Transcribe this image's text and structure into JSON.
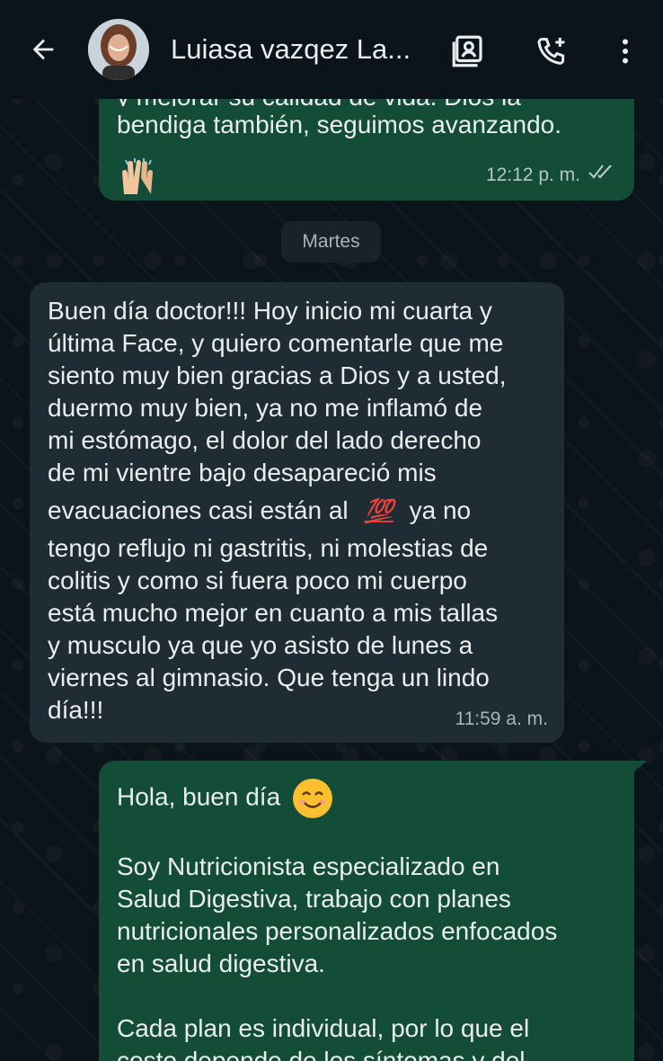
{
  "header": {
    "contact_name": "Luiasa vazqez La...",
    "back_icon": "arrow-left-icon",
    "contact_card_icon": "contact-card-icon",
    "add_call_icon": "phone-plus-icon",
    "menu_icon": "more-vertical-icon"
  },
  "messages": [
    {
      "direction": "out",
      "text": "bendiga también, seguimos avanzando.",
      "top_partial": "y mejorar su calidad de vida. Dios la",
      "emoji": "raised-hands-emoji",
      "time": "12:12 p. m.",
      "status": "read"
    },
    {
      "direction": "in",
      "text_lines": [
        "Buen día doctor!!! Hoy inicio mi cuarta y",
        "última Face, y quiero comentarle que me",
        "siento muy bien gracias a Dios y a usted,",
        "duermo muy bien, ya no me inflamó de",
        "mi estómago, el dolor del lado derecho",
        "de mi vientre bajo desapareció mis",
        "evacuaciones casi están al",
        "ya no",
        "tengo reflujo ni gastritis, ni molestias de",
        "colitis y como si fuera poco mi cuerpo",
        "está mucho mejor en cuanto a mis tallas",
        "y musculo ya que yo asisto de lunes a",
        "viernes al gimnasio. Que tenga un lindo",
        "día!!!"
      ],
      "emoji_100": "💯",
      "time": "11:59 a. m."
    },
    {
      "direction": "out",
      "greeting": "Hola, buen día",
      "emoji": "smiling-face-emoji",
      "para1_lines": [
        "Soy Nutricionista especializado en",
        "Salud Digestiva, trabajo con planes",
        "nutricionales personalizados enfocados",
        "en salud digestiva."
      ],
      "para2_lines": [
        "Cada plan es individual, por lo que el",
        "costo depende de los síntomas y del"
      ]
    }
  ],
  "day_separator": "Martes",
  "colors": {
    "background": "#0b141a",
    "outgoing_bubble": "#144d37",
    "incoming_bubble": "#202c33",
    "text": "#e9edef",
    "read_tick": "#b5c8be"
  }
}
